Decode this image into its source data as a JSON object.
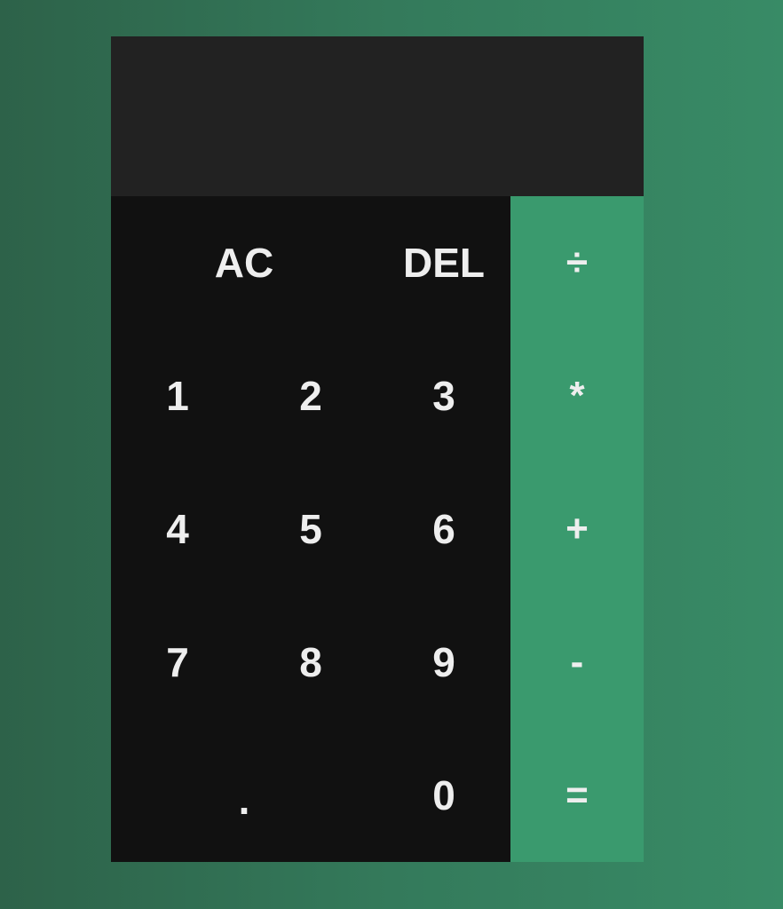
{
  "display": {
    "previous_operand": "",
    "current_operand": ""
  },
  "keys": {
    "ac": "AC",
    "del": "DEL",
    "divide": "÷",
    "one": "1",
    "two": "2",
    "three": "3",
    "multiply": "*",
    "four": "4",
    "five": "5",
    "six": "6",
    "add": "+",
    "seven": "7",
    "eight": "8",
    "nine": "9",
    "subtract": "-",
    "dot": ".",
    "zero": "0",
    "equals": "="
  },
  "colors": {
    "background_start": "#2d6249",
    "background_end": "#388b66",
    "display_bg": "#222222",
    "keypad_bg": "#111111",
    "operator_bg": "#3a9a6e",
    "text": "#eeeeee"
  }
}
